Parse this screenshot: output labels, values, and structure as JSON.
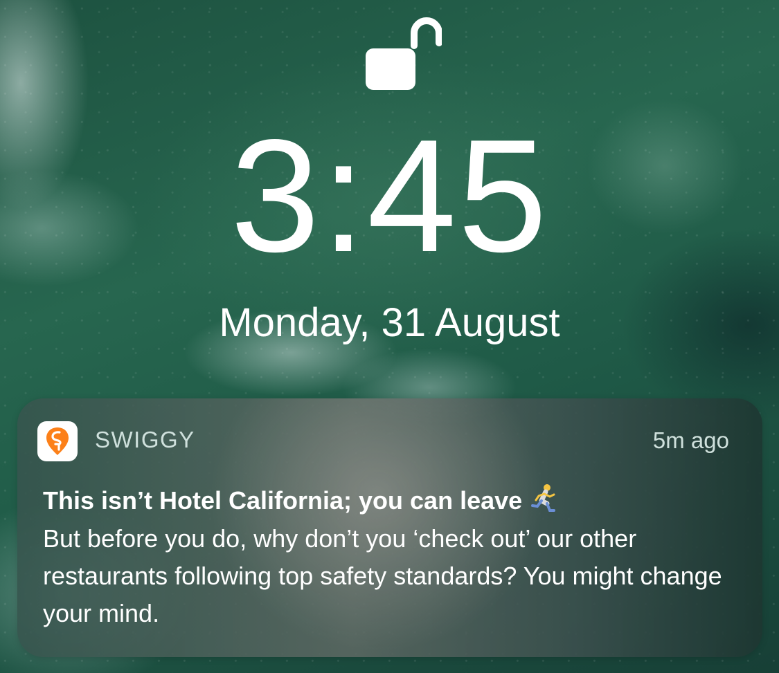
{
  "lock_screen": {
    "lock_icon": "unlocked-padlock-icon",
    "time": "3:45",
    "date": "Monday, 31 August"
  },
  "notification": {
    "app_icon": "swiggy-logo-icon",
    "app_name": "SWIGGY",
    "timestamp": "5m ago",
    "title": "This isn’t Hotel California; you can leave",
    "title_emoji_icon": "running-man-emoji-icon",
    "body": "But before you do, why don’t you ‘check out’ our other restaurants following top safety standards? You might change your mind."
  },
  "colors": {
    "swiggy_orange": "#fc8019",
    "wallpaper_green": "#1f5a45"
  }
}
